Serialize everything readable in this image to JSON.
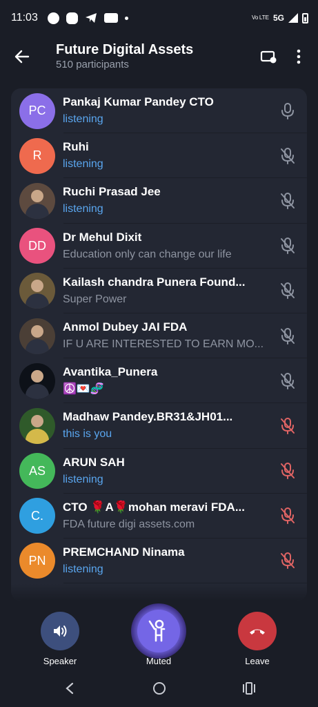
{
  "status_bar": {
    "time": "11:03",
    "volte": "Vo LTE",
    "network": "5G"
  },
  "header": {
    "title": "Future Digital Assets",
    "subtitle": "510 participants"
  },
  "participants": [
    {
      "name": "Pankaj Kumar Pandey CTO",
      "status": "listening",
      "status_color": "blue",
      "initials": "PC",
      "avatar_color": "#8b6fe8",
      "mic": "on"
    },
    {
      "name": "Ruhi",
      "status": "listening",
      "status_color": "blue",
      "initials": "R",
      "avatar_color": "#ef6a4e",
      "mic": "off"
    },
    {
      "name": "Ruchi Prasad Jee",
      "status": "listening",
      "status_color": "blue",
      "initials": "",
      "avatar_color": "#5d4a3f",
      "mic": "off"
    },
    {
      "name": "Dr Mehul Dixit",
      "status": "Education only can change our life",
      "status_color": "gray",
      "initials": "DD",
      "avatar_color": "#e9527e",
      "mic": "off"
    },
    {
      "name": "Kailash chandra Punera Found...",
      "status": "Super Power",
      "status_color": "gray",
      "initials": "",
      "avatar_color": "#6b5a3a",
      "mic": "off"
    },
    {
      "name": "Anmol Dubey JAI FDA",
      "status": "IF U ARE INTERESTED TO EARN MO...",
      "status_color": "gray",
      "initials": "",
      "avatar_color": "#4b3f36",
      "mic": "off"
    },
    {
      "name": "Avantika_Punera",
      "status": "☮️💌🧬",
      "status_color": "gray",
      "initials": "",
      "avatar_color": "#0d1118",
      "mic": "off"
    },
    {
      "name": "Madhaw Pandey.BR31&JH01...",
      "status": "this is you",
      "status_color": "blue",
      "initials": "",
      "avatar_color": "#2f5a2a",
      "mic": "muted"
    },
    {
      "name": "ARUN SAH",
      "status": "listening",
      "status_color": "blue",
      "initials": "AS",
      "avatar_color": "#44b85a",
      "mic": "muted"
    },
    {
      "name": "CTO 🌹A🌹mohan meravi FDA...",
      "status": "FDA future digi assets.com",
      "status_color": "gray",
      "initials": "C.",
      "avatar_color": "#2f9fe0",
      "mic": "muted"
    },
    {
      "name": "PREMCHAND Ninama",
      "status": "listening",
      "status_color": "blue",
      "initials": "PN",
      "avatar_color": "#eb8a2b",
      "mic": "muted"
    }
  ],
  "controls": {
    "speaker_label": "Speaker",
    "mute_label": "Muted",
    "leave_label": "Leave"
  },
  "colors": {
    "background": "#1a1d26",
    "card": "#232733",
    "accent_blue": "#5aa6ef",
    "muted_red": "#e06464",
    "leave_red": "#c9383f",
    "speaker_btn": "#3d4f7d",
    "mute_btn": "#7466e6"
  }
}
